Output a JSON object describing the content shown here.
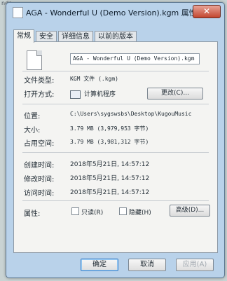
{
  "background": {
    "corner_text": "nde"
  },
  "window": {
    "title": "AGA - Wonderful U (Demo Version).kgm 属性",
    "close_label": "✕"
  },
  "tabs": [
    {
      "label": "常规",
      "active": true
    },
    {
      "label": "安全",
      "active": false
    },
    {
      "label": "详细信息",
      "active": false
    },
    {
      "label": "以前的版本",
      "active": false
    }
  ],
  "general": {
    "filename": "AGA - Wonderful U (Demo Version).kgm",
    "file_type_label": "文件类型:",
    "file_type_value": "KGM 文件 (.kgm)",
    "open_with_label": "打开方式:",
    "open_with_value": "计算机程序",
    "change_button": "更改(C)...",
    "location_label": "位置:",
    "location_value": "C:\\Users\\sygswsbs\\Desktop\\KugouMusic",
    "size_label": "大小:",
    "size_value": "3.79 MB (3,979,953 字节)",
    "size_on_disk_label": "占用空间:",
    "size_on_disk_value": "3.79 MB (3,981,312 字节)",
    "created_label": "创建时间:",
    "created_value": "2018年5月21日, 14:57:12",
    "modified_label": "修改时间:",
    "modified_value": "2018年5月21日, 14:57:12",
    "accessed_label": "访问时间:",
    "accessed_value": "2018年5月21日, 14:57:12",
    "attributes_label": "属性:",
    "readonly_label": "只读(R)",
    "hidden_label": "隐藏(H)",
    "advanced_button": "高级(D)..."
  },
  "footer": {
    "ok": "确定",
    "cancel": "取消",
    "apply": "应用(A)"
  }
}
